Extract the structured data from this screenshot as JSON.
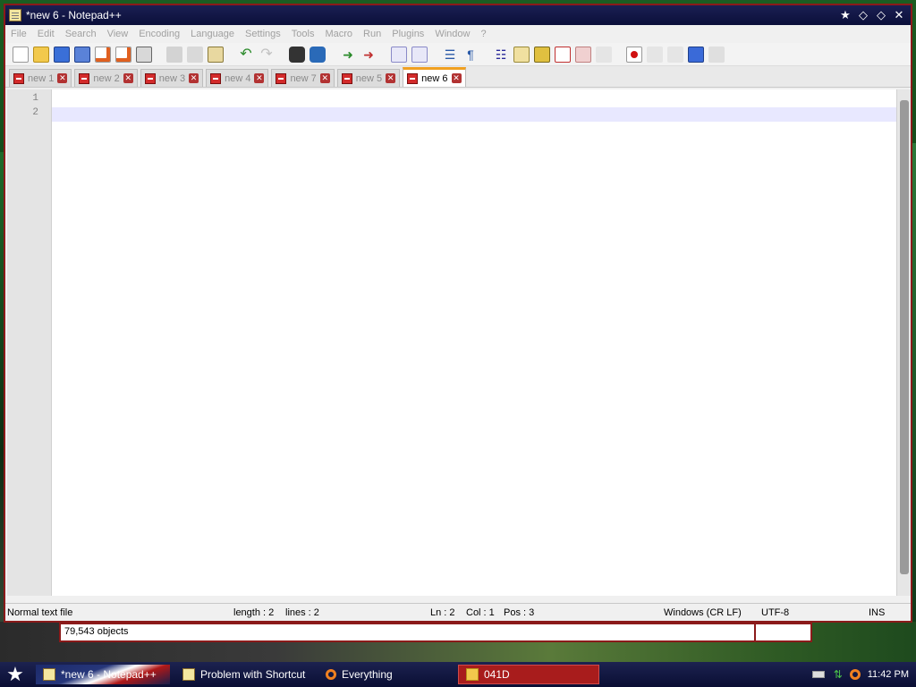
{
  "window": {
    "title": "*new 6 - Notepad++"
  },
  "menu": [
    "File",
    "Edit",
    "Search",
    "View",
    "Encoding",
    "Language",
    "Settings",
    "Tools",
    "Macro",
    "Run",
    "Plugins",
    "Window",
    "?"
  ],
  "toolbar_icons": [
    "new-file",
    "open-file",
    "save",
    "save-all",
    "close",
    "close-all",
    "print",
    "cut",
    "copy",
    "paste",
    "undo",
    "redo",
    "find",
    "replace",
    "zoom-in",
    "zoom-out",
    "sync-vertical",
    "sync-horizontal",
    "word-wrap",
    "show-all-chars",
    "indent-guide",
    "user-defined-language",
    "doc-map",
    "function-list",
    "folder-workspace",
    "monitoring",
    "record-macro",
    "stop-macro",
    "playback-macro",
    "run-macro-multiple",
    "save-macro"
  ],
  "tabs": [
    {
      "label": "new 1"
    },
    {
      "label": "new 2"
    },
    {
      "label": "new 3"
    },
    {
      "label": "new 4"
    },
    {
      "label": "new 7"
    },
    {
      "label": "new 5"
    },
    {
      "label": "new 6",
      "active": true
    }
  ],
  "editor": {
    "line_numbers": [
      "1",
      "2"
    ]
  },
  "status": {
    "file_type": "Normal text file",
    "length": "length : 2",
    "lines": "lines : 2",
    "ln": "Ln : 2",
    "col": "Col : 1",
    "pos": "Pos : 3",
    "eol": "Windows (CR LF)",
    "encoding": "UTF-8",
    "mode": "INS"
  },
  "explorer_status": {
    "objects": "79,543 objects"
  },
  "taskbar": {
    "items": [
      "*new 6 - Notepad++",
      "Problem with Shortcut",
      "Everything",
      "041D"
    ],
    "clock": "11:42 PM"
  },
  "colors": {
    "window_border": "#8b1a1a",
    "titlebar": "#0b0f3a",
    "active_tab_accent": "#f0a020",
    "current_line": "#e8e8ff"
  }
}
